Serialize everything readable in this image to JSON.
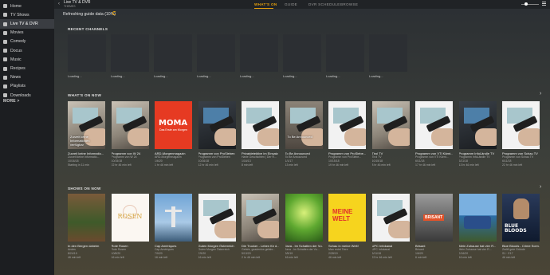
{
  "sidebar": {
    "items": [
      {
        "label": "Home",
        "icon": "home-icon"
      },
      {
        "label": "TV Shows",
        "icon": "tv-icon"
      },
      {
        "label": "Live TV & DVR",
        "icon": "broadcast-icon",
        "active": true
      },
      {
        "label": "Movies",
        "icon": "film-icon"
      },
      {
        "label": "Comedy",
        "icon": "film-icon"
      },
      {
        "label": "Docus",
        "icon": "film-icon"
      },
      {
        "label": "Music",
        "icon": "music-icon"
      },
      {
        "label": "Recipes",
        "icon": "folder-icon"
      },
      {
        "label": "News",
        "icon": "film-icon"
      },
      {
        "label": "Playlists",
        "icon": "playlist-icon"
      },
      {
        "label": "Downloads",
        "icon": "download-icon"
      }
    ],
    "more_label": "MORE >"
  },
  "header": {
    "title": "Live TV & DVR",
    "subtitle": "THEMES",
    "tabs": [
      {
        "label": "WHAT'S ON",
        "active": true
      },
      {
        "label": "GUIDE"
      },
      {
        "label": "DVR SCHEDULE"
      },
      {
        "label": "BROWSE"
      }
    ],
    "accent": "#e5a00d"
  },
  "status": "Refreshing guide data (10%)",
  "recent": {
    "title": "RECENT CHANNELS",
    "boxes": [
      "Loading...",
      "Loading...",
      "Loading...",
      "Loading...",
      "Loading...",
      "Loading...",
      "Loading...",
      "Loading..."
    ]
  },
  "whats_on": {
    "title": "WHAT'S ON NOW",
    "items": [
      {
        "title": "Zurzeit keine Informatio...",
        "sub1": "Zurzeit keine Informatio...",
        "sub2": "10/16/18",
        "sub3": "Starting in 11 min",
        "overlay": "Zurzeit keine Informationen verfügbar",
        "poster": "tv"
      },
      {
        "title": "Programm von W 24",
        "sub1": "Programm von W 24",
        "sub2": "10/15/18",
        "sub3": "22 hr 46 min left",
        "poster": "tv"
      },
      {
        "title": "ARD-Morgenmagazin",
        "sub1": "ARD-Morgenmagazin",
        "sub2": "1/6/20",
        "sub3": "1 hr 46 min left",
        "poster": "moma",
        "logo": "MOMA",
        "logo_sub": "Das Erste am Morgen"
      },
      {
        "title": "Programm von ProSieben",
        "sub1": "Programm von ProSieben",
        "sub2": "10/16/18",
        "sub3": "12 hr 46 min left",
        "poster": "tvblack"
      },
      {
        "title": "Privatdetektive im Einsatz",
        "sub1": "Harte Geschichten | Der R...",
        "sub2": "1/16/13",
        "sub3": "8 min left",
        "poster": "white"
      },
      {
        "title": "To Be Announced",
        "sub1": "To Be Announced",
        "sub2": "1/1/17",
        "sub3": "13 min left",
        "overlay": "To Be Announced",
        "poster": "tobe"
      },
      {
        "title": "Programm von ProSiebe...",
        "sub1": "Programm von ProSiebe...",
        "sub2": "10/15/18",
        "sub3": "19 hr 46 min left",
        "poster": "white"
      },
      {
        "title": "Tirol TV",
        "sub1": "Tirol TV",
        "sub2": "10/15/18",
        "sub3": "8 hr 46 min left",
        "poster": "tv"
      },
      {
        "title": "Programm von VTI Kärnt...",
        "sub1": "Programm von VTI Kärnt...",
        "sub2": "6/11/18",
        "sub3": "17 hr 46 min left",
        "poster": "white"
      },
      {
        "title": "Programm InfoLändle TV",
        "sub1": "Programm InfoLändle TV",
        "sub2": "6/11/18",
        "sub3": "13 hr 46 min left",
        "poster": "tvblack"
      },
      {
        "title": "Programm von Schau TV",
        "sub1": "Programm von Schau TV",
        "sub2": "6/11/18",
        "sub3": "22 hr 46 min left",
        "poster": "white"
      }
    ]
  },
  "shows_on": {
    "title": "SHOWS ON NOW",
    "items": [
      {
        "title": "In den Bergen daheim",
        "sub1": "Andes",
        "sub2": "8/24/19",
        "sub3": "46 min left",
        "poster": "forest"
      },
      {
        "title": "Rote Rosen",
        "sub1": "Rote Rosen",
        "sub2": "10/8/20",
        "sub3": "46 min left",
        "poster": "rosen",
        "logo": "ROSEN"
      },
      {
        "title": "Cap Amériques",
        "sub1": "Cap Amériques",
        "sub2": "7/9/20",
        "sub3": "16 min left",
        "poster": "sky"
      },
      {
        "title": "Guten Morgen Österreich",
        "sub1": "Guten Morgen Österreich",
        "sub2": "7/9/20",
        "sub3": "16 min left",
        "poster": "white"
      },
      {
        "title": "Die Trucker - Leben für d...",
        "sub1": "Gefahr, gnadenlos gefahr...",
        "sub2": "5/13/20",
        "sub3": "2 hr 46 min left",
        "poster": "tv"
      },
      {
        "title": "Java - Im Schatten der Vu...",
        "sub1": "Java - Im Schatten der Vu...",
        "sub2": "3/5/19",
        "sub3": "46 min left",
        "poster": "green"
      },
      {
        "title": "Schau in meine Welt!",
        "sub1": "Man redet Tiere",
        "sub2": "2/28/19",
        "sub3": "46 min left",
        "poster": "meine",
        "logo": "MEINE WELT"
      },
      {
        "title": "UPC Infokanal",
        "sub1": "UPC Infokanal",
        "sub2": "6/11/18",
        "sub3": "22 hr 46 min left",
        "poster": "white"
      },
      {
        "title": "Brisant",
        "sub1": "Brisant",
        "sub2": "1/6/20",
        "sub3": "6 min left",
        "poster": "brisant",
        "logo": "BRISANT"
      },
      {
        "title": "Mein Zuhause hat vier R...",
        "sub1": "Mein Zuhause hat vier R...",
        "sub2": "2/16/20",
        "sub3": "16 min left",
        "poster": "house"
      },
      {
        "title": "Blue Bloods - Crime Scen...",
        "sub1": "Zwölf gute Gründe",
        "sub2": "S1 · E17",
        "sub3": "46 min left",
        "poster": "blue",
        "logo": "BLUE BLOODS"
      }
    ]
  }
}
